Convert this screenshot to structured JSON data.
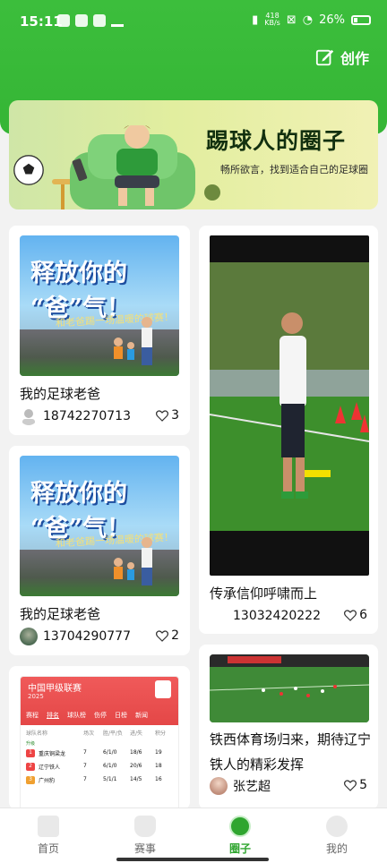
{
  "status": {
    "time": "15:11",
    "speed_value": "418",
    "speed_unit": "KB/s",
    "battery": "26%"
  },
  "header": {
    "create_label": "创作"
  },
  "banner": {
    "title": "踢球人的圈子",
    "subtitle": "畅所欲言，找到适合自己的足球圈"
  },
  "poster": {
    "headline_line1": "释放你的",
    "headline_line2": "“爸”气！",
    "tagline": "和老爸踢一场温暖的球赛！"
  },
  "posts": [
    {
      "title": "我的足球老爸",
      "author": "18742270713",
      "likes": "3"
    },
    {
      "title": "传承信仰呼啸而上",
      "author": "13032420222",
      "likes": "6"
    },
    {
      "title": "我的足球老爸",
      "author": "13704290777",
      "likes": "2"
    },
    {
      "title": "铁西体育场归来，期待辽宁铁人的精彩发挥",
      "author": "张艺超",
      "likes": "5"
    }
  ],
  "league": {
    "title": "中国甲级联赛",
    "year": "2025",
    "tabs": [
      "赛程",
      "排名",
      "球队榜",
      "伤停",
      "日榜",
      "新闻"
    ],
    "headers": [
      "球队名称",
      "场次",
      "胜/平/负",
      "进/失",
      "积分"
    ],
    "section": "升级",
    "rows": [
      [
        "1",
        "重庆铜梁龙",
        "7",
        "6/1/0",
        "18/6",
        "19"
      ],
      [
        "2",
        "辽宁铁人",
        "7",
        "6/1/0",
        "20/6",
        "18"
      ],
      [
        "3",
        "广州豹",
        "7",
        "5/1/1",
        "14/5",
        "16"
      ]
    ]
  },
  "nav": {
    "items": [
      {
        "label": "首页"
      },
      {
        "label": "赛事"
      },
      {
        "label": "圈子"
      },
      {
        "label": "我的"
      }
    ]
  },
  "colors": {
    "brand_green": "#35b535",
    "highlight_red": "#e11d1d"
  }
}
